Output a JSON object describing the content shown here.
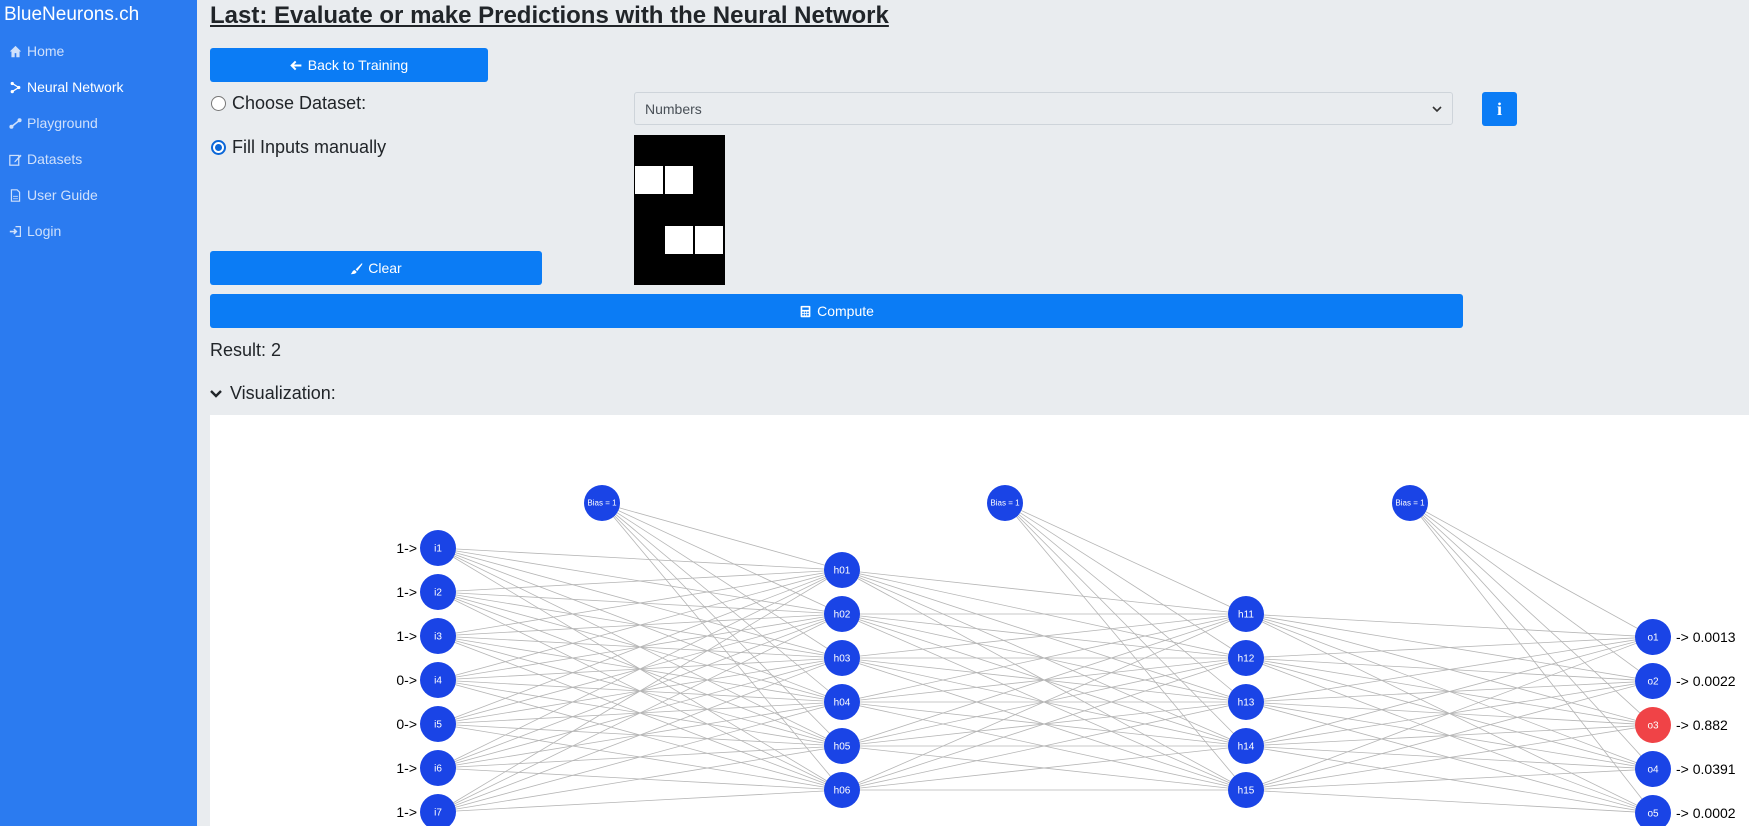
{
  "brand": "BlueNeurons.ch",
  "sidebar": {
    "items": [
      {
        "label": "Home",
        "icon": "home-icon",
        "active": false
      },
      {
        "label": "Neural Network",
        "icon": "network-icon",
        "active": true
      },
      {
        "label": "Playground",
        "icon": "playground-icon",
        "active": false
      },
      {
        "label": "Datasets",
        "icon": "edit-icon",
        "active": false
      },
      {
        "label": "User Guide",
        "icon": "file-icon",
        "active": false
      },
      {
        "label": "Login",
        "icon": "login-icon",
        "active": false
      }
    ]
  },
  "page": {
    "title": "Last: Evaluate or make Predictions with the Neural Network",
    "back_label": "Back to Training",
    "choose_dataset_label": "Choose Dataset:",
    "fill_manual_label": "Fill Inputs manually",
    "dataset_selected": "Numbers",
    "clear_label": "Clear",
    "compute_label": "Compute",
    "result_text": "Result: 2",
    "visualization_label": "Visualization:"
  },
  "input_grid": {
    "rows": 5,
    "cols": 3,
    "cells": [
      0,
      0,
      0,
      1,
      1,
      0,
      0,
      0,
      0,
      0,
      1,
      1,
      0,
      0,
      0
    ]
  },
  "network": {
    "bias_label": "Bias = 1",
    "inputs": [
      {
        "name": "i1",
        "value": "1->"
      },
      {
        "name": "i2",
        "value": "1->"
      },
      {
        "name": "i3",
        "value": "1->"
      },
      {
        "name": "i4",
        "value": "0->"
      },
      {
        "name": "i5",
        "value": "0->"
      },
      {
        "name": "i6",
        "value": "1->"
      },
      {
        "name": "i7",
        "value": "1->"
      }
    ],
    "hidden1": [
      "h01",
      "h02",
      "h03",
      "h04",
      "h05",
      "h06"
    ],
    "hidden2": [
      "h11",
      "h12",
      "h13",
      "h14",
      "h15"
    ],
    "outputs": [
      {
        "name": "o1",
        "value": "-> 0.0013",
        "highlight": false
      },
      {
        "name": "o2",
        "value": "-> 0.0022",
        "highlight": false
      },
      {
        "name": "o3",
        "value": "-> 0.882",
        "highlight": true
      },
      {
        "name": "o4",
        "value": "-> 0.0391",
        "highlight": false
      },
      {
        "name": "o5",
        "value": "-> 0.0002",
        "highlight": false
      }
    ],
    "node_color": "#1a44e6",
    "highlight_color": "#f04347",
    "edge_color": "#b5b5b5"
  }
}
